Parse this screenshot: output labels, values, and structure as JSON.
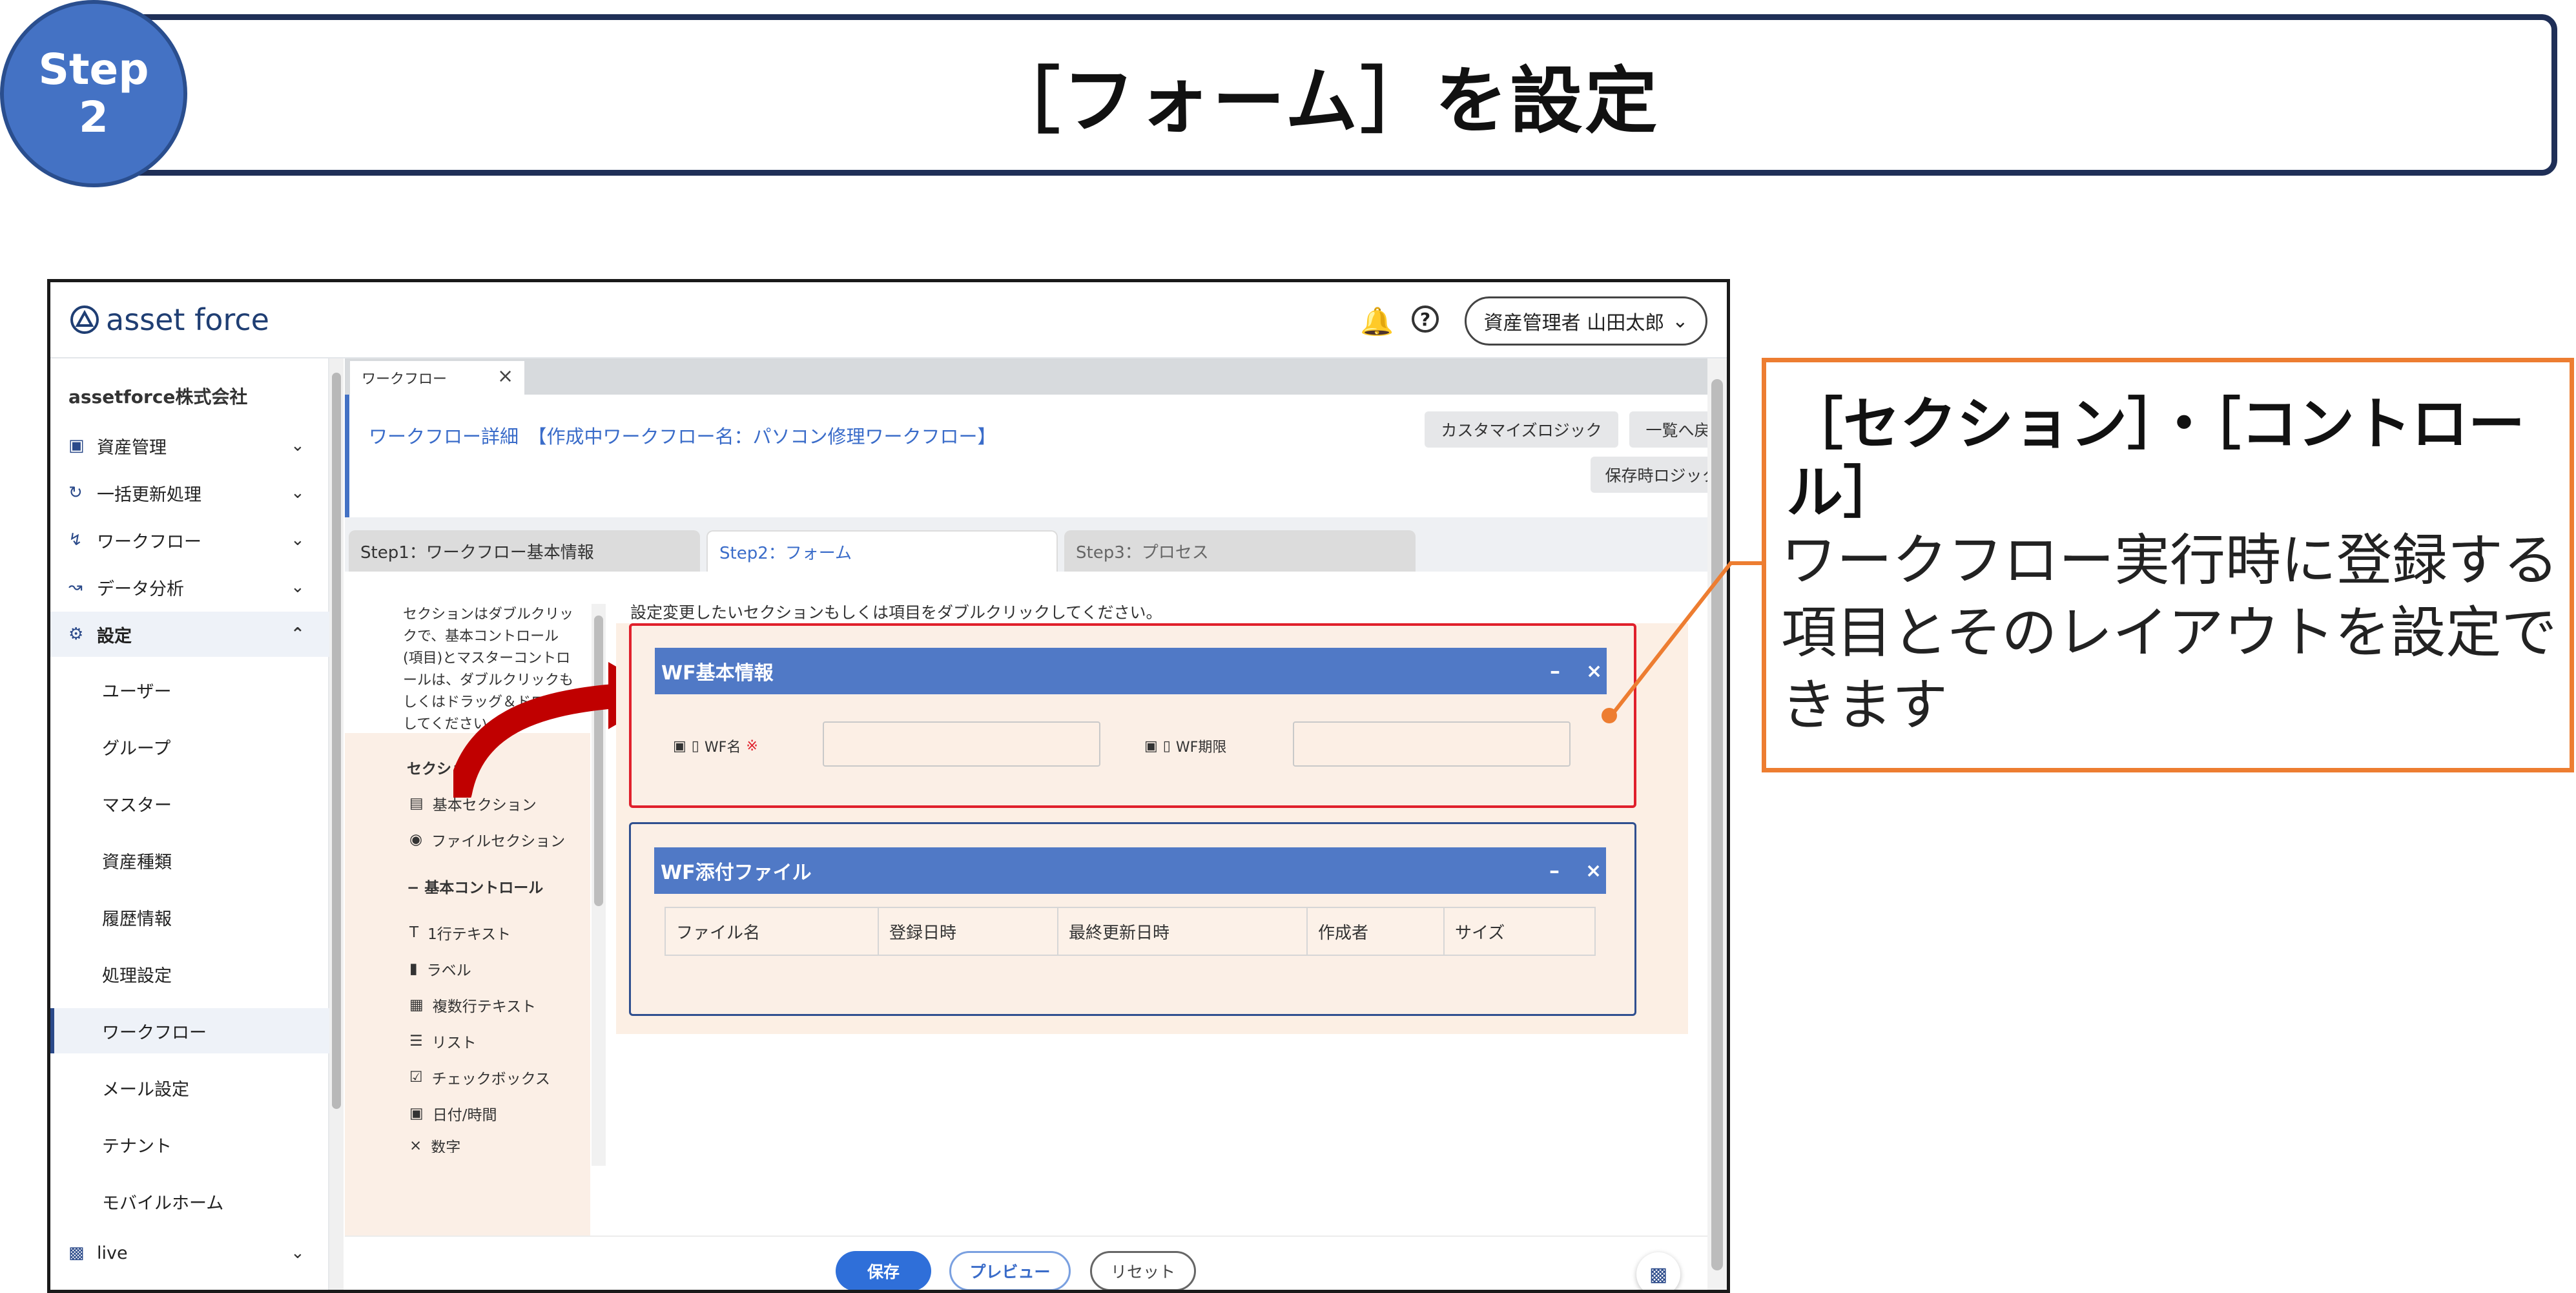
{
  "banner": {
    "step_line1": "Step",
    "step_line2": "2",
    "title": "［フォーム］を設定"
  },
  "app": {
    "logo": "asset force",
    "user": "資産管理者 山田太郎",
    "company": "assetforce株式会社",
    "sidebar": [
      {
        "label": "資産管理",
        "icon": "cube-icon"
      },
      {
        "label": "一括更新処理",
        "icon": "refresh-icon"
      },
      {
        "label": "ワークフロー",
        "icon": "workflow-icon"
      },
      {
        "label": "データ分析",
        "icon": "analytics-icon"
      },
      {
        "label": "設定",
        "icon": "gear-icon"
      }
    ],
    "settings_sub": [
      "ユーザー",
      "グループ",
      "マスター",
      "資産種類",
      "履歴情報",
      "処理設定",
      "ワークフロー",
      "メール設定",
      "テナント",
      "モバイルホーム"
    ],
    "live": "live",
    "tab": "ワークフロー",
    "page_title": "ワークフロー詳細　【作成中ワークフロー名：パソコン修理ワークフロー】",
    "buttons": {
      "customize": "カスタマイズロジック",
      "back": "一覧へ戻る",
      "save_logic": "保存時ロジック"
    },
    "steps": [
      "Step1：ワークフロー基本情報",
      "Step2：フォーム",
      "Step3：プロセス"
    ],
    "help_text": "セクションはダブルクリックで、基本コントロール(項目)とマスターコントロールは、ダブルクリックもしくはドラッグ＆ドロップしてください",
    "palette": {
      "section_head": "セクション",
      "sections": [
        "基本セクション",
        "ファイルセクション"
      ],
      "controls_head": "基本コントロール",
      "controls": [
        {
          "label": "1行テキスト",
          "icon": "text-icon"
        },
        {
          "label": "ラベル",
          "icon": "label-icon"
        },
        {
          "label": "複数行テキスト",
          "icon": "multiline-icon"
        },
        {
          "label": "リスト",
          "icon": "list-icon"
        },
        {
          "label": "チェックボックス",
          "icon": "checkbox-icon"
        },
        {
          "label": "日付/時間",
          "icon": "calendar-icon"
        },
        {
          "label": "数字",
          "icon": "number-icon"
        }
      ]
    },
    "instruction": "設定変更したいセクションもしくは項目をダブルクリックしてください。",
    "section1": {
      "title": "WF基本情報",
      "field1": "WF名",
      "required": "※",
      "field2": "WF期限"
    },
    "section2": {
      "title": "WF添付ファイル",
      "columns": [
        "ファイル名",
        "登録日時",
        "最終更新日時",
        "作成者",
        "サイズ"
      ]
    },
    "footer": {
      "save": "保存",
      "preview": "プレビュー",
      "reset": "リセット"
    }
  },
  "callout": {
    "title": "［セクション］・［コントロール］",
    "body": "ワークフロー実行時に登録する項目とそのレイアウトを設定できます"
  },
  "colors": {
    "accent": "#4472c4",
    "navy": "#1f2f57",
    "orange": "#ed7d31",
    "red": "#c00000",
    "section_header": "#5079c6"
  }
}
